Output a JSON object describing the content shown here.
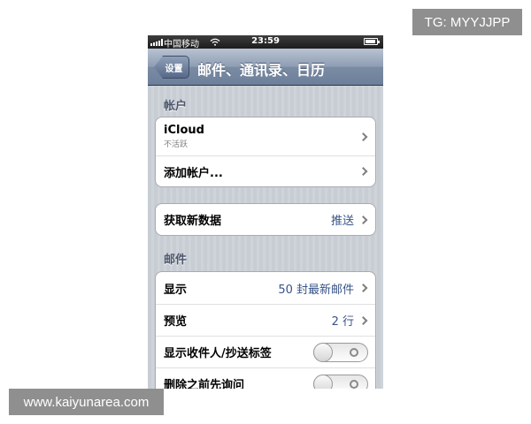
{
  "overlays": {
    "tg_label": "TG: MYYJJPP",
    "url_label": "www.kaiyunarea.com"
  },
  "status_bar": {
    "carrier": "中国移动",
    "time": "23:59"
  },
  "nav": {
    "back_label": "设置",
    "title": "邮件、通讯录、日历"
  },
  "sections": {
    "accounts_header": "帐户",
    "mail_header": "邮件"
  },
  "accounts": {
    "icloud_label": "iCloud",
    "icloud_status": "不活跃",
    "add_account_label": "添加帐户..."
  },
  "fetch": {
    "label": "获取新数据",
    "value": "推送"
  },
  "mail": {
    "show_label": "显示",
    "show_value": "50 封最新邮件",
    "preview_label": "预览",
    "preview_value": "2 行",
    "show_to_cc_label": "显示收件人/抄送标签",
    "show_to_cc_on": false,
    "ask_before_delete_label": "删除之前先询问",
    "ask_before_delete_on": false
  },
  "colors": {
    "nav_bar": "#7a8ba4",
    "value_text": "#385487",
    "section_header": "#4c566c"
  }
}
